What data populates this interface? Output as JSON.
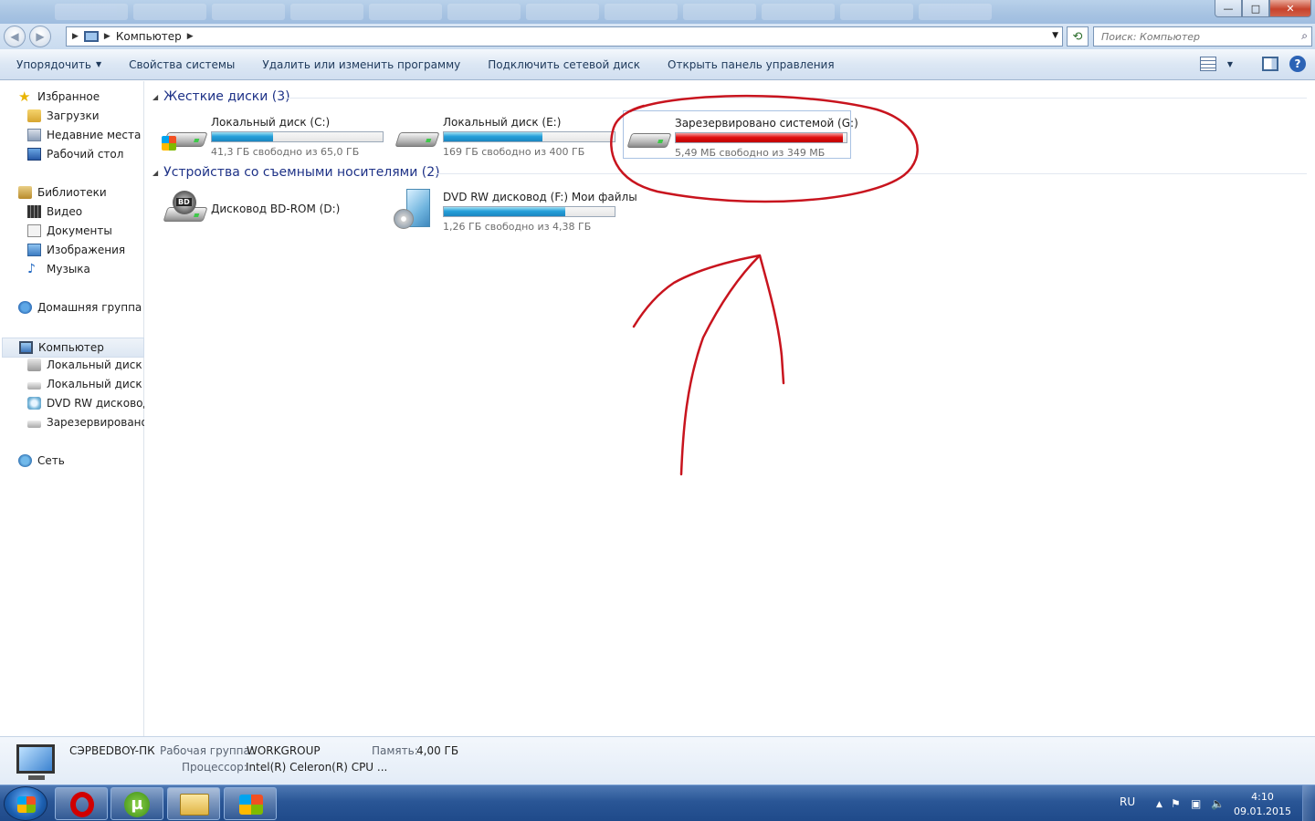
{
  "window": {
    "controls": {
      "minimize": "—",
      "maximize": "□",
      "close": "✕"
    }
  },
  "address": {
    "breadcrumb": "Компьютер",
    "search_placeholder": "Поиск: Компьютер"
  },
  "toolbar": {
    "organize": "Упорядочить",
    "system_properties": "Свойства системы",
    "uninstall": "Удалить или изменить программу",
    "map_drive": "Подключить сетевой диск",
    "control_panel": "Открыть панель управления"
  },
  "sidebar": {
    "favorites": "Избранное",
    "downloads": "Загрузки",
    "recent": "Недавние места",
    "desktop": "Рабочий стол",
    "libraries": "Библиотеки",
    "video": "Видео",
    "documents": "Документы",
    "images": "Изображения",
    "music": "Музыка",
    "homegroup": "Домашняя группа",
    "computer": "Компьютер",
    "drive_c": "Локальный диск (C",
    "drive_e": "Локальный диск (E:",
    "drive_f": "DVD RW дисковод (",
    "drive_g": "Зарезервировано с",
    "network": "Сеть"
  },
  "groups": {
    "hard_disks": "Жесткие диски (3)",
    "removable": "Устройства со съемными носителями (2)"
  },
  "drives": {
    "c": {
      "name": "Локальный диск (C:)",
      "free": "41,3 ГБ свободно из 65,0 ГБ",
      "used_fraction": 0.36
    },
    "e": {
      "name": "Локальный диск (E:)",
      "free": "169 ГБ свободно из 400 ГБ",
      "used_fraction": 0.58
    },
    "g": {
      "name": "Зарезервировано системой (G:)",
      "free": "5,49 МБ свободно из 349 МБ",
      "used_fraction": 0.98
    },
    "d": {
      "name": "Дисковод BD-ROM (D:)"
    },
    "f": {
      "name": "DVD RW дисковод (F:) Мои файлы",
      "free": "1,26 ГБ свободно из 4,38 ГБ",
      "used_fraction": 0.71
    }
  },
  "details": {
    "pc_name": "СЭРВЕDBOY-ПК",
    "workgroup_label": "Рабочая группа:",
    "workgroup": "WORKGROUP",
    "memory_label": "Память:",
    "memory": "4,00 ГБ",
    "cpu_label": "Процессор:",
    "cpu": "Intel(R) Celeron(R) CPU ..."
  },
  "taskbar": {
    "lang": "RU",
    "time": "4:10",
    "date": "09.01.2015",
    "utorrent_glyph": "µ"
  },
  "colors": {
    "bar_normal": "#26a0da",
    "bar_full": "#e01010",
    "annotation": "#c8141e"
  }
}
